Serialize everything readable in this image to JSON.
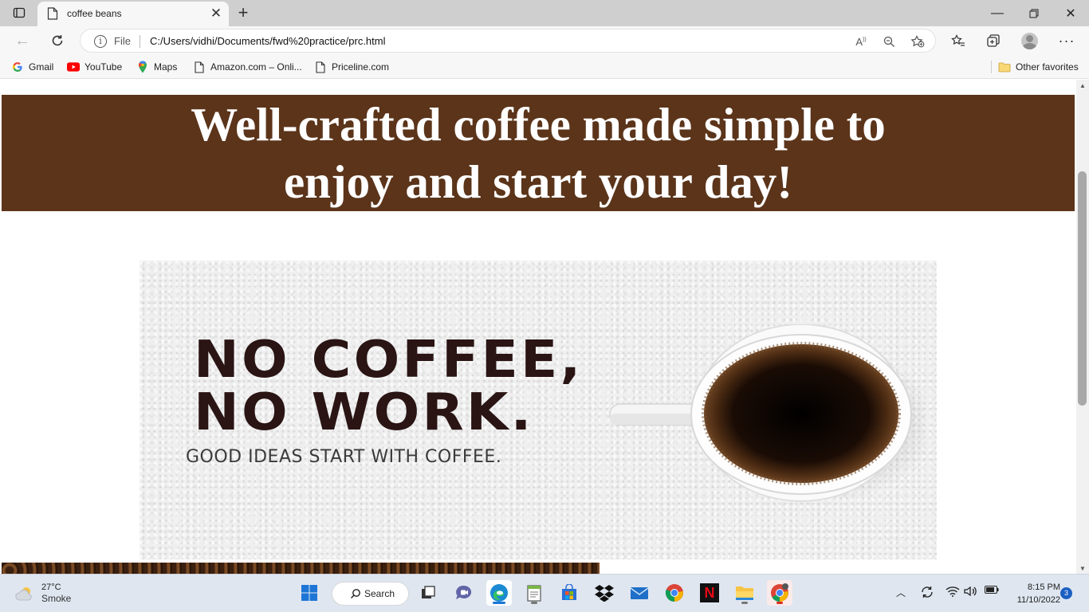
{
  "browser": {
    "tab": {
      "title": "coffee beans"
    },
    "address_bar": {
      "security_label": "File",
      "url": "C:/Users/vidhi/Documents/fwd%20practice/prc.html"
    },
    "favorites": [
      {
        "label": "Gmail",
        "icon": "gmail-icon"
      },
      {
        "label": "YouTube",
        "icon": "youtube-icon"
      },
      {
        "label": "Maps",
        "icon": "maps-icon"
      },
      {
        "label": "Amazon.com – Onli...",
        "icon": "page-icon"
      },
      {
        "label": "Priceline.com",
        "icon": "page-icon"
      }
    ],
    "other_favorites": "Other favorites"
  },
  "page": {
    "hero_title": "Well-crafted coffee made simple to enjoy and start your day!",
    "banner_color": "#5b341a",
    "promo": {
      "line1": "NO COFFEE,",
      "line2": "NO WORK.",
      "tagline": "GOOD IDEAS START WITH COFFEE."
    }
  },
  "taskbar": {
    "weather": {
      "temp": "27°C",
      "condition": "Smoke"
    },
    "search_label": "Search",
    "clock": {
      "time": "8:15 PM",
      "date": "11/10/2022"
    },
    "notification_count": "3",
    "apps": [
      "start-icon",
      "task-view-icon",
      "teams-chat-icon",
      "edge-icon",
      "notepad-icon",
      "store-icon",
      "dropbox-icon",
      "mail-icon",
      "chrome-icon",
      "netflix-icon",
      "file-explorer-icon",
      "chrome-dev-icon"
    ]
  }
}
